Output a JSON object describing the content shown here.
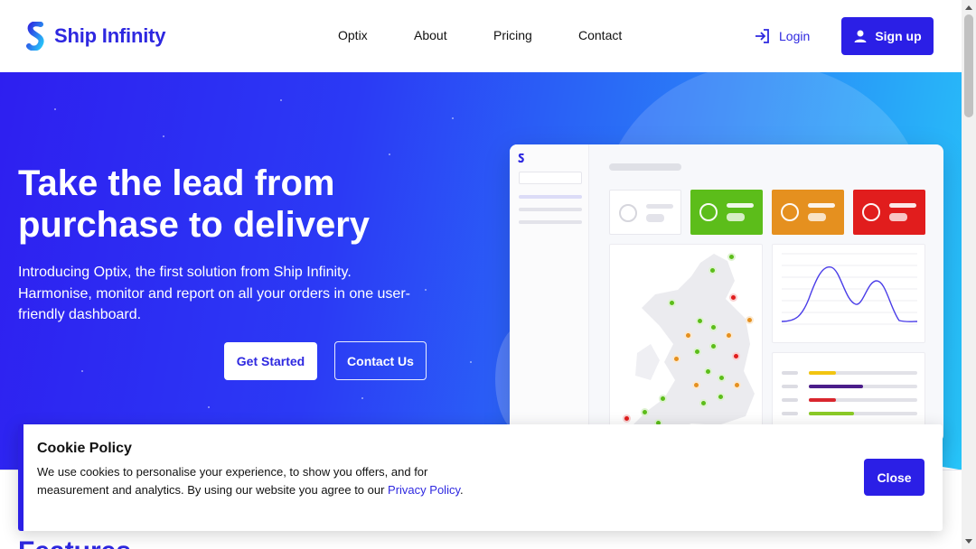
{
  "header": {
    "brand_name": "Ship Infinity",
    "nav": [
      {
        "label": "Optix"
      },
      {
        "label": "About"
      },
      {
        "label": "Pricing"
      },
      {
        "label": "Contact"
      }
    ],
    "login_label": "Login",
    "signup_label": "Sign up",
    "brand_color": "#2e28e0"
  },
  "hero": {
    "title": "Take the lead from purchase to delivery",
    "subtitle": "Introducing Optix, the first solution from Ship Infinity. Harmonise, monitor and report on all your orders in one user-friendly dashboard.",
    "get_started_label": "Get Started",
    "contact_label": "Contact Us",
    "gradient_start": "#2e1ff0",
    "gradient_end": "#27c5f9"
  },
  "dashboard_preview": {
    "status_cards": [
      {
        "color": "#ffffff"
      },
      {
        "color": "#5cbd1a"
      },
      {
        "color": "#e5901f"
      },
      {
        "color": "#e11d1d"
      }
    ],
    "progress_bars": [
      {
        "color": "#f2c511",
        "fraction": 0.25
      },
      {
        "color": "#4b1d8a",
        "fraction": 0.5
      },
      {
        "color": "#d9262e",
        "fraction": 0.25
      },
      {
        "color": "#8ac926",
        "fraction": 0.42
      }
    ],
    "map_dot_colors": {
      "ok": "#5cbd1a",
      "warn": "#e5901f",
      "alert": "#e11d1d"
    }
  },
  "features_heading_peek": "Features",
  "cookie": {
    "title": "Cookie Policy",
    "text": "We use cookies to personalise your experience, to show you offers, and for measurement and analytics. By using our website you agree to our ",
    "link_text": "Privacy Policy",
    "end_text": ".",
    "close_label": "Close"
  }
}
